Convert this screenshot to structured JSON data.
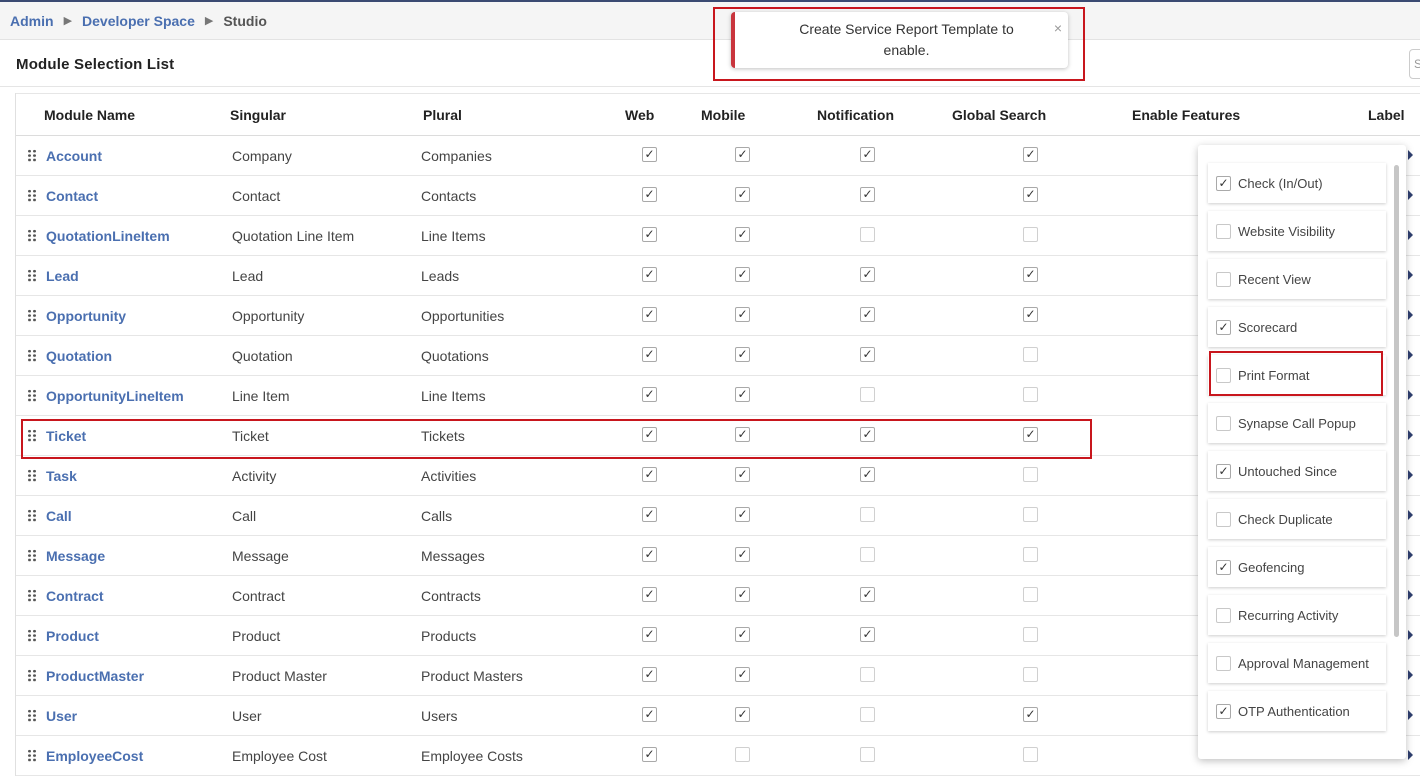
{
  "breadcrumb": {
    "items": [
      "Admin",
      "Developer Space",
      "Studio"
    ]
  },
  "page_title": "Module Selection List",
  "search_placeholder": "S",
  "toast": {
    "message": "Create Service Report Template to enable.",
    "close": "×"
  },
  "table": {
    "columns": [
      "Module Name",
      "Singular",
      "Plural",
      "Web",
      "Mobile",
      "Notification",
      "Global Search",
      "Enable Features",
      "Label"
    ],
    "rows": [
      {
        "module": "Account",
        "singular": "Company",
        "plural": "Companies",
        "web": true,
        "mobile": true,
        "notification": true,
        "global_search": true
      },
      {
        "module": "Contact",
        "singular": "Contact",
        "plural": "Contacts",
        "web": true,
        "mobile": true,
        "notification": true,
        "global_search": true
      },
      {
        "module": "QuotationLineItem",
        "singular": "Quotation Line Item",
        "plural": "Line Items",
        "web": true,
        "mobile": true,
        "notification": false,
        "global_search": false
      },
      {
        "module": "Lead",
        "singular": "Lead",
        "plural": "Leads",
        "web": true,
        "mobile": true,
        "notification": true,
        "global_search": true
      },
      {
        "module": "Opportunity",
        "singular": "Opportunity",
        "plural": "Opportunities",
        "web": true,
        "mobile": true,
        "notification": true,
        "global_search": true
      },
      {
        "module": "Quotation",
        "singular": "Quotation",
        "plural": "Quotations",
        "web": true,
        "mobile": true,
        "notification": true,
        "global_search": false
      },
      {
        "module": "OpportunityLineItem",
        "singular": "Line Item",
        "plural": "Line Items",
        "web": true,
        "mobile": true,
        "notification": false,
        "global_search": false
      },
      {
        "module": "Ticket",
        "singular": "Ticket",
        "plural": "Tickets",
        "web": true,
        "mobile": true,
        "notification": true,
        "global_search": true
      },
      {
        "module": "Task",
        "singular": "Activity",
        "plural": "Activities",
        "web": true,
        "mobile": true,
        "notification": true,
        "global_search": false
      },
      {
        "module": "Call",
        "singular": "Call",
        "plural": "Calls",
        "web": true,
        "mobile": true,
        "notification": false,
        "global_search": false
      },
      {
        "module": "Message",
        "singular": "Message",
        "plural": "Messages",
        "web": true,
        "mobile": true,
        "notification": false,
        "global_search": false
      },
      {
        "module": "Contract",
        "singular": "Contract",
        "plural": "Contracts",
        "web": true,
        "mobile": true,
        "notification": true,
        "global_search": false
      },
      {
        "module": "Product",
        "singular": "Product",
        "plural": "Products",
        "web": true,
        "mobile": true,
        "notification": true,
        "global_search": false
      },
      {
        "module": "ProductMaster",
        "singular": "Product Master",
        "plural": "Product Masters",
        "web": true,
        "mobile": true,
        "notification": false,
        "global_search": false
      },
      {
        "module": "User",
        "singular": "User",
        "plural": "Users",
        "web": true,
        "mobile": true,
        "notification": false,
        "global_search": true
      },
      {
        "module": "EmployeeCost",
        "singular": "Employee Cost",
        "plural": "Employee Costs",
        "web": true,
        "mobile": false,
        "notification": false,
        "global_search": false
      }
    ]
  },
  "features_dropdown": {
    "items": [
      {
        "label": "Check (In/Out)",
        "checked": true
      },
      {
        "label": "Website Visibility",
        "checked": false
      },
      {
        "label": "Recent View",
        "checked": false
      },
      {
        "label": "Scorecard",
        "checked": true
      },
      {
        "label": "Print Format",
        "checked": false
      },
      {
        "label": "Synapse Call Popup",
        "checked": false
      },
      {
        "label": "Untouched Since",
        "checked": true
      },
      {
        "label": "Check Duplicate",
        "checked": false
      },
      {
        "label": "Geofencing",
        "checked": true
      },
      {
        "label": "Recurring Activity",
        "checked": false
      },
      {
        "label": "Approval Management",
        "checked": false
      },
      {
        "label": "OTP Authentication",
        "checked": true
      }
    ]
  },
  "colors": {
    "link": "#4a6fb0",
    "highlight": "#c8161d",
    "toast_accent": "#c9353d",
    "arrow": "#2f3f6f"
  },
  "check_glyph": "✓"
}
